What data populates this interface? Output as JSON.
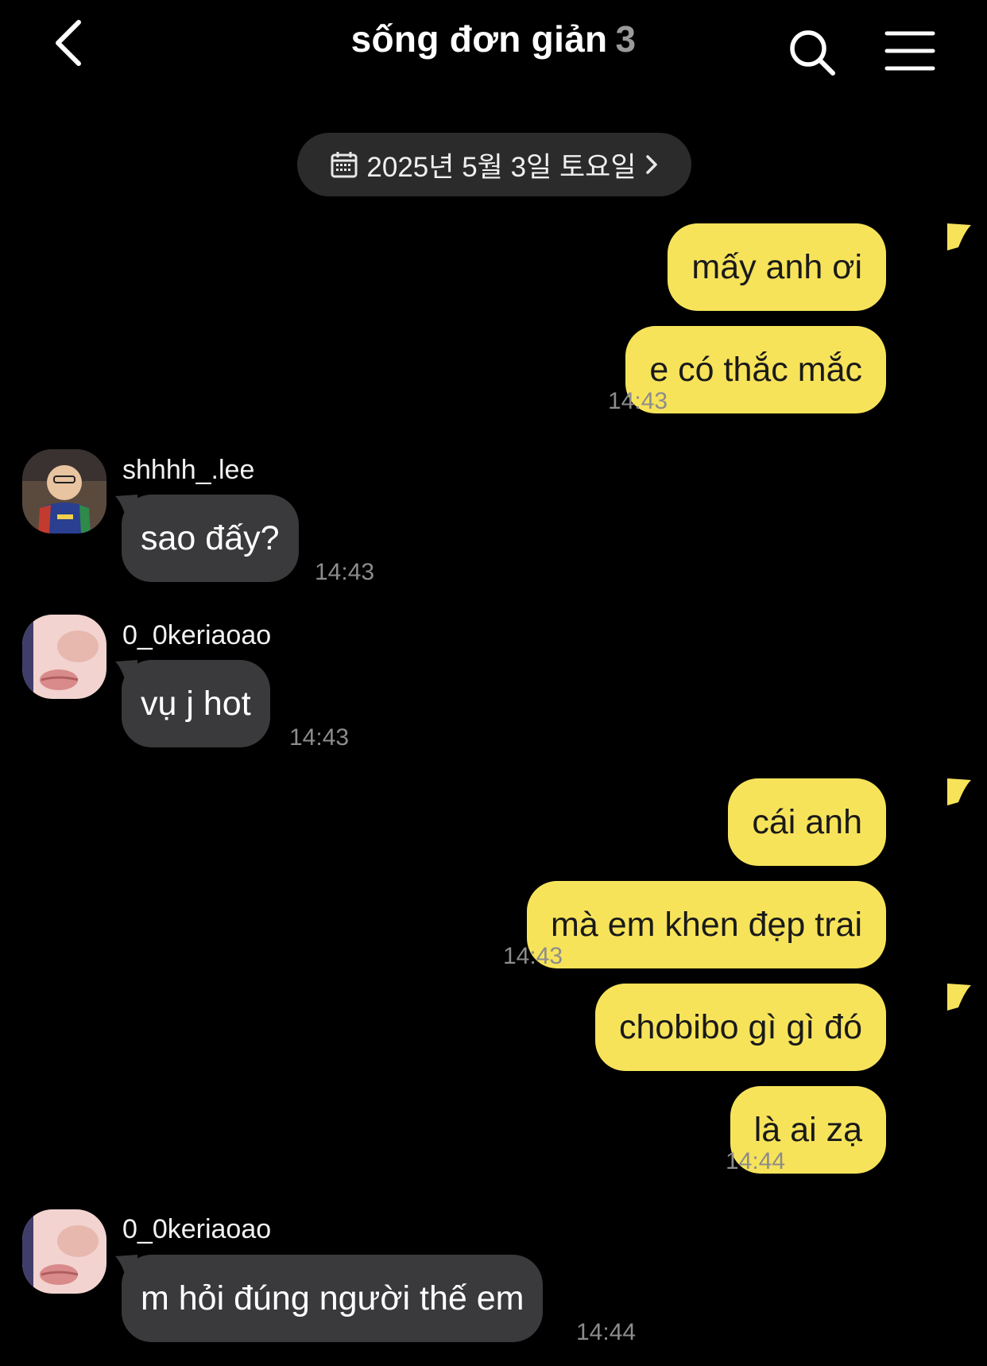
{
  "header": {
    "title": "sống đơn giản",
    "member_count": "3",
    "back_icon": "chevron-left-icon",
    "search_icon": "search-icon",
    "menu_icon": "menu-icon"
  },
  "date_divider": {
    "label": "2025년 5월 3일 토요일",
    "icon": "calendar-icon",
    "chevron": "chevron-right-icon"
  },
  "messages": [
    {
      "from": "me",
      "text": "mấy anh ơi"
    },
    {
      "from": "me",
      "text": "e có thắc mắc",
      "time": "14:43"
    },
    {
      "from": "shhhh_.lee",
      "text": "sao đấy?",
      "time": "14:43"
    },
    {
      "from": "0_0keriaoao",
      "text": "vụ j hot",
      "time": "14:43"
    },
    {
      "from": "me",
      "text": "cái anh"
    },
    {
      "from": "me",
      "text": "mà em khen đẹp trai",
      "time": "14:43"
    },
    {
      "from": "me",
      "text": "chobibo gì gì đó"
    },
    {
      "from": "me",
      "text": "là ai zạ",
      "time": "14:44"
    },
    {
      "from": "0_0keriaoao",
      "text": "m hỏi đúng người thế em",
      "time": "14:44"
    }
  ],
  "colors": {
    "background": "#000000",
    "my_bubble": "#f7e35a",
    "other_bubble": "#3a3a3c",
    "timestamp": "#8c8c8c"
  }
}
